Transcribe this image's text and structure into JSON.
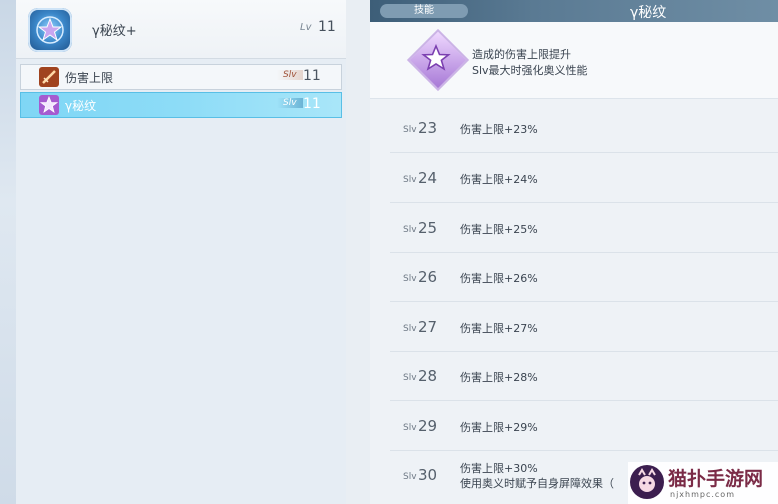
{
  "header": {
    "title": "γ秘纹+",
    "lv_prefix": "Lv",
    "lv_value": "11"
  },
  "skills": [
    {
      "name": "伤害上限",
      "slv_label": "Slv",
      "slv_value": "11",
      "icon": "sword-icon",
      "selected": false
    },
    {
      "name": "γ秘纹",
      "slv_label": "Slv",
      "slv_value": "11",
      "icon": "star-icon",
      "selected": true
    }
  ],
  "detail": {
    "category": "技能",
    "title": "γ秘纹",
    "description": [
      "造成的伤害上限提升",
      "Slv最大时强化奥义性能"
    ]
  },
  "levels": [
    {
      "prefix": "Slv",
      "level": "23",
      "effect": "伤害上限+23%"
    },
    {
      "prefix": "Slv",
      "level": "24",
      "effect": "伤害上限+24%"
    },
    {
      "prefix": "Slv",
      "level": "25",
      "effect": "伤害上限+25%"
    },
    {
      "prefix": "Slv",
      "level": "26",
      "effect": "伤害上限+26%"
    },
    {
      "prefix": "Slv",
      "level": "27",
      "effect": "伤害上限+27%"
    },
    {
      "prefix": "Slv",
      "level": "28",
      "effect": "伤害上限+28%"
    },
    {
      "prefix": "Slv",
      "level": "29",
      "effect": "伤害上限+29%"
    },
    {
      "prefix": "Slv",
      "level": "30",
      "effect": "伤害上限+30%",
      "effect2": "使用奥义时赋予自身屏障效果（"
    }
  ],
  "watermark": {
    "name": "猫扑手游网",
    "url": "njxhmpc.com"
  }
}
